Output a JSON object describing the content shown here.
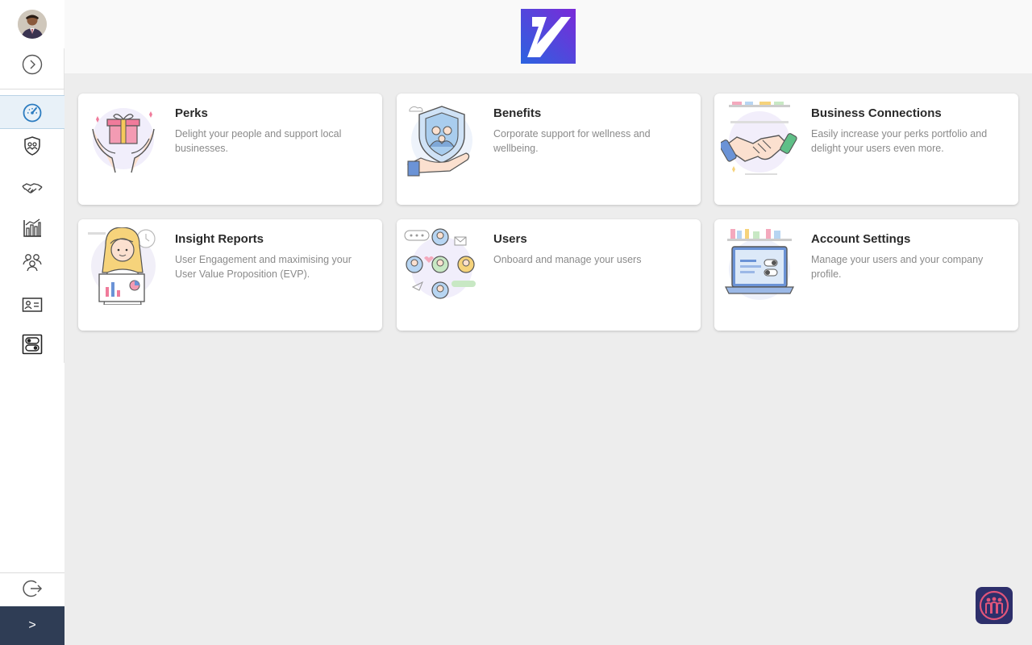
{
  "sidebar": {
    "avatar_icon": "user-avatar",
    "expand_icon": "chevron-right-circle-icon",
    "items": [
      {
        "name": "dashboard",
        "icon": "speedometer-icon",
        "active": true
      },
      {
        "name": "benefits",
        "icon": "shield-people-icon",
        "active": false
      },
      {
        "name": "connections",
        "icon": "handshake-icon",
        "active": false
      },
      {
        "name": "reports",
        "icon": "bar-chart-icon",
        "active": false
      },
      {
        "name": "users",
        "icon": "users-group-icon",
        "active": false
      },
      {
        "name": "profile",
        "icon": "id-card-icon",
        "active": false
      },
      {
        "name": "settings",
        "icon": "settings-panel-icon",
        "active": false
      }
    ],
    "logout_icon": "logout-icon",
    "collapse_label": ">"
  },
  "header": {
    "logo": "brand-logo"
  },
  "cards": [
    {
      "title": "Perks",
      "description": "Delight your people and support local businesses."
    },
    {
      "title": "Benefits",
      "description": "Corporate support for wellness and wellbeing."
    },
    {
      "title": "Business Connections",
      "description": "Easily increase your perks portfolio and delight your users even more."
    },
    {
      "title": "Insight Reports",
      "description": "User Engagement and maximising your User Value Proposition (EVP)."
    },
    {
      "title": "Users",
      "description": "Onboard and manage your users"
    },
    {
      "title": "Account Settings",
      "description": "Manage your users and your company profile."
    }
  ],
  "colors": {
    "accent": "#2c7cc0",
    "sidebar_collapse_bg": "#2f3d55",
    "page_bg": "#ededed"
  }
}
